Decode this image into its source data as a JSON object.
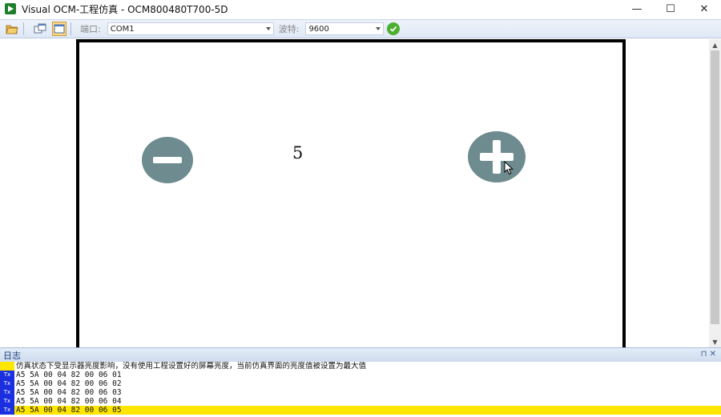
{
  "window": {
    "title": "Visual OCM-工程仿真 - OCM800480T700-5D",
    "minimize_glyph": "—",
    "maximize_glyph": "☐",
    "close_glyph": "✕"
  },
  "toolbar": {
    "port_label": "端口:",
    "port_value": "COM1",
    "baud_label": "波特:",
    "baud_value": "9600"
  },
  "screen": {
    "value": "5",
    "minus_icon": "minus-circle-icon",
    "plus_icon": "plus-circle-icon"
  },
  "log": {
    "title": "日志",
    "controls": "⊓ ✕",
    "lines": [
      {
        "tag": "",
        "type": "info",
        "text": "仿真状态下受显示器亮度影响，没有使用工程设置好的屏幕亮度，当前仿真界面的亮度值被设置为最大值"
      },
      {
        "tag": "Tx",
        "type": "tx",
        "text": "A5 5A 00 04 82 00 06 01"
      },
      {
        "tag": "Tx",
        "type": "tx",
        "text": "A5 5A 00 04 82 00 06 02"
      },
      {
        "tag": "Tx",
        "type": "tx",
        "text": "A5 5A 00 04 82 00 06 03"
      },
      {
        "tag": "Tx",
        "type": "tx",
        "text": "A5 5A 00 04 82 00 06 04"
      },
      {
        "tag": "Tx",
        "type": "tx",
        "text": "A5 5A 00 04 82 00 06 05"
      }
    ]
  },
  "colors": {
    "button_fill": "#6e8b8f",
    "log_highlight": "#ffe600",
    "tx_tag": "#1a2fe0"
  }
}
